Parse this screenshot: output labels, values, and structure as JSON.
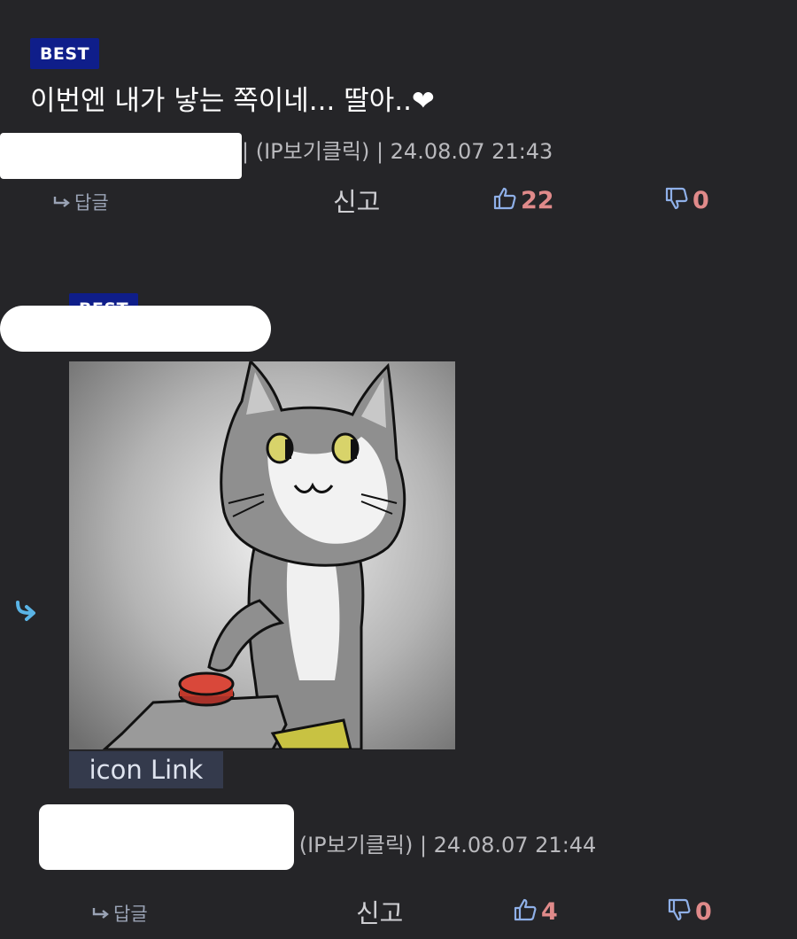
{
  "comment1": {
    "badge": "BEST",
    "text": "이번엔 내가 낳는 쪽이네... 딸아..❤",
    "meta": "| (IP보기클릭) | 24.08.07 21:43",
    "reply_label": "답글",
    "report_label": "신고",
    "likes": "22",
    "dislikes": "0"
  },
  "comment2": {
    "badge": "BEST",
    "image_link_label": "icon Link",
    "meta": "| (IP보기클릭) | 24.08.07 21:44",
    "reply_label": "답글",
    "report_label": "신고",
    "likes": "4",
    "dislikes": "0"
  },
  "icons": {
    "reply": "reply-arrow-icon",
    "like": "thumbs-up-icon",
    "dislike": "thumbs-down-icon",
    "nested_reply": "nested-reply-arrow-icon"
  },
  "colors": {
    "background": "#252528",
    "badge": "#0f1e8a",
    "count": "#e08a8a",
    "reply_arrow": "#5ab4e6"
  }
}
